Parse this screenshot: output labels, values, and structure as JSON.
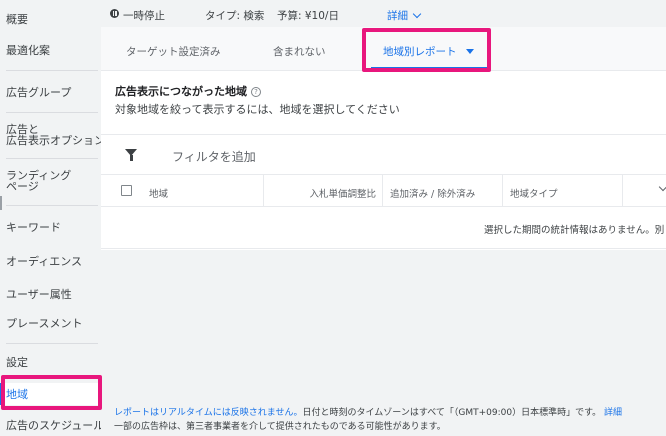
{
  "sidebar": {
    "items": [
      {
        "label": "概要"
      },
      {
        "label": "最適化案"
      },
      {
        "label": "広告グループ"
      },
      {
        "label": "広告と\n広告表示オプション"
      },
      {
        "label": "ランディング\nページ"
      },
      {
        "label": "キーワード"
      },
      {
        "label": "オーディエンス"
      },
      {
        "label": "ユーザー属性"
      },
      {
        "label": "プレースメント"
      },
      {
        "label": "設定"
      },
      {
        "label": "地域"
      },
      {
        "label": "広告のスケジュール"
      }
    ]
  },
  "status_bar": {
    "status": "一時停止",
    "type": "タイプ: 検索",
    "budget": "予算: ¥10/日",
    "details": "詳細"
  },
  "tabs": [
    {
      "label": "ターゲット設定済み"
    },
    {
      "label": "含まれない"
    },
    {
      "label": "地域別レポート"
    }
  ],
  "section": {
    "title": "広告表示につながった地域",
    "help_glyph": "?",
    "subtitle": "対象地域を絞って表示するには、地域を選択してください"
  },
  "filter": {
    "label": "フィルタを追加"
  },
  "table": {
    "columns": [
      "地域",
      "入札単価調整比",
      "追加済み / 除外済み",
      "地域タイプ"
    ],
    "empty_message": "選択した期間の統計情報はありません。別"
  },
  "footer": {
    "line1_link": "レポートはリアルタイムには反映されません。",
    "line1_text": "日付と時刻のタイムゾーンはすべて「（GMT+09:00）日本標準時」です。",
    "line1_more": "詳細",
    "line2": "一部の広告枠は、第三者事業者を介して提供されたものである可能性があります。"
  },
  "colors": {
    "accent": "#1a73e8",
    "highlight": "#e8177d"
  }
}
